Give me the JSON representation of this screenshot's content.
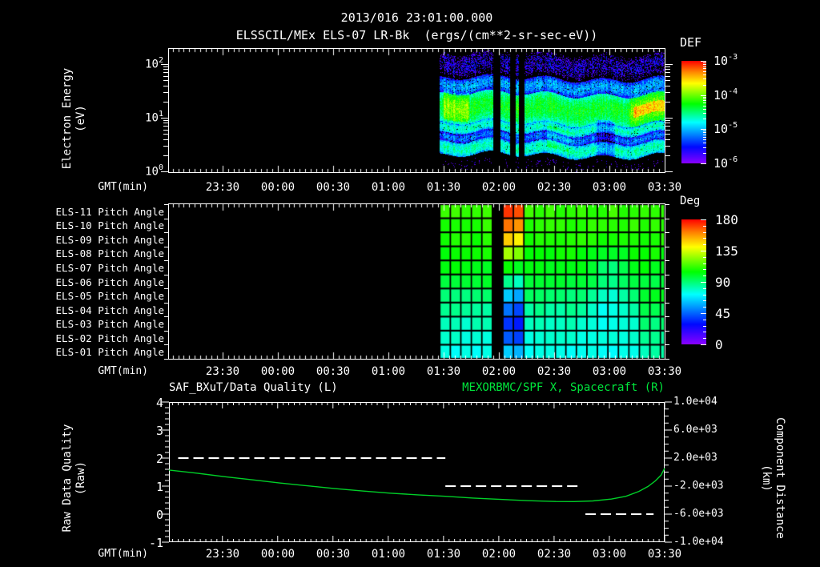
{
  "header": {
    "title": "2013/016 23:01:00.000",
    "subtitle": "ELSSCIL/MEx ELS-07 LR-Bk  (ergs/(cm**2-sr-sec-eV))"
  },
  "time_axis": {
    "label": "GMT(min)",
    "ticks": [
      "23:30",
      "00:00",
      "00:30",
      "01:00",
      "01:30",
      "02:00",
      "02:30",
      "03:00",
      "03:30"
    ]
  },
  "panel1": {
    "ylabel_line1": "Electron Energy",
    "ylabel_line2": "(eV)",
    "ytick_exponents": [
      "2",
      "1",
      "0"
    ],
    "colorbar": {
      "title": "DEF",
      "tick_exponents": [
        "-3",
        "-4",
        "-5",
        "-6"
      ]
    }
  },
  "panel2": {
    "row_labels": [
      "ELS-11 Pitch Angle",
      "ELS-10 Pitch Angle",
      "ELS-09 Pitch Angle",
      "ELS-08 Pitch Angle",
      "ELS-07 Pitch Angle",
      "ELS-06 Pitch Angle",
      "ELS-05 Pitch Angle",
      "ELS-04 Pitch Angle",
      "ELS-03 Pitch Angle",
      "ELS-02 Pitch Angle",
      "ELS-01 Pitch Angle"
    ],
    "colorbar": {
      "title": "Deg",
      "ticks": [
        "180",
        "135",
        "90",
        "45",
        "0"
      ]
    }
  },
  "panel3": {
    "title_left": "SAF_BXuT/Data Quality (L)",
    "title_right": "MEXORBMC/SPF X, Spacecraft (R)",
    "ylabel_left_line1": "Raw Data Quality",
    "ylabel_left_line2": "(Raw)",
    "ylabel_right_line1": "Component Distance",
    "ylabel_right_line2": "(km)",
    "yticks_left": [
      "4",
      "3",
      "2",
      "1",
      "0",
      "-1"
    ],
    "yticks_right": [
      "1.0e+04",
      "6.0e+03",
      "2.0e+03",
      "-2.0e+03",
      "-6.0e+03",
      "-1.0e+04"
    ]
  },
  "colors": {
    "background": "#000000",
    "text": "#ffffff",
    "green_title": "#00e63c",
    "curve_green": "#00cf28",
    "quality_white": "#ffffff"
  },
  "chart_data": [
    {
      "type": "heatmap",
      "name": "electron-energy-spectrogram",
      "title": "ELSSCIL/MEx ELS-07 LR-Bk",
      "units": "ergs/(cm**2-sr-sec-eV)",
      "xlabel": "GMT(min)",
      "ylabel": "Electron Energy (eV)",
      "x_start": "23:01",
      "x_end": "03:30",
      "total_min": 269,
      "x_tick_labels": [
        "23:30",
        "00:00",
        "00:30",
        "01:00",
        "01:30",
        "02:00",
        "02:30",
        "03:00",
        "03:30"
      ],
      "y_scale": "log",
      "y_range_ev": [
        1,
        170
      ],
      "colorbar": {
        "label": "DEF",
        "scale": "log",
        "min": 1e-06,
        "max": 0.001
      },
      "data_start_min": 147,
      "data_gaps_min": [
        [
          176,
          180
        ],
        [
          185,
          188
        ],
        [
          190,
          193
        ]
      ],
      "energy_bands": [
        {
          "e": [
            1.0,
            2.0
          ],
          "flux": 8e-07,
          "dropout": 0.62
        },
        {
          "e": [
            2.0,
            3.6
          ],
          "flux": 1.6e-05,
          "dropout": 0.02
        },
        {
          "e": [
            3.6,
            5.2
          ],
          "flux": 4.5e-06,
          "dropout": 0.05
        },
        {
          "e": [
            5.2,
            8.0
          ],
          "flux": 1.5e-05,
          "dropout": 0.02
        },
        {
          "e": [
            8.0,
            28.0
          ],
          "flux": 4e-05,
          "dropout": 0.0
        },
        {
          "e": [
            28.0,
            55.0
          ],
          "flux": 6e-06,
          "dropout": 0.05
        },
        {
          "e": [
            55.0,
            170.0
          ],
          "flux": 1.6e-06,
          "dropout": 0.3
        }
      ],
      "bright_patches": [
        {
          "t": [
            149,
            163
          ],
          "e": [
            9,
            30
          ],
          "factor": 2.6
        },
        {
          "t": [
            250,
            269
          ],
          "e": [
            8,
            30
          ],
          "factor": 2.2
        },
        {
          "t": [
            252,
            269
          ],
          "e": [
            12,
            19
          ],
          "factor": 3.2
        },
        {
          "t": [
            232,
            242
          ],
          "e": [
            2,
            9
          ],
          "factor": 0.45
        },
        {
          "t": [
            205,
            220
          ],
          "e": [
            2.6,
            6.5
          ],
          "factor": 1.6
        }
      ]
    },
    {
      "type": "heatmap",
      "name": "pitch-angle-panel",
      "rows": [
        "ELS-11",
        "ELS-10",
        "ELS-09",
        "ELS-08",
        "ELS-07",
        "ELS-06",
        "ELS-05",
        "ELS-04",
        "ELS-03",
        "ELS-02",
        "ELS-01"
      ],
      "colorbar": {
        "label": "Deg",
        "min": 0,
        "max": 180,
        "tick_labels": [
          "180",
          "135",
          "90",
          "45",
          "0"
        ]
      },
      "data_start_min": 147,
      "data_gaps_min": [
        [
          176,
          180
        ],
        [
          185,
          188
        ],
        [
          190,
          193
        ],
        [
          264.5,
          267
        ]
      ],
      "column_width_min": 5.7,
      "baseline_deg": [
        108,
        106,
        104,
        101,
        97,
        91,
        83,
        76,
        70,
        66,
        63
      ],
      "stripes": [
        {
          "t": [
            180,
            185
          ],
          "values_deg": [
            172,
            162,
            148,
            126,
            101,
            78,
            52,
            38,
            28,
            34,
            52
          ]
        },
        {
          "t": [
            188,
            190
          ],
          "values_deg": [
            168,
            157,
            142,
            120,
            95,
            70,
            46,
            31,
            24,
            30,
            48
          ]
        }
      ],
      "cyan_blob": {
        "t": [
          226,
          252
        ],
        "rows": [
          3,
          8
        ],
        "delta_deg": -17,
        "center_min": 239,
        "half_width_min": 13
      },
      "right_green": {
        "t": [
          255,
          269
        ],
        "rows": [
          6,
          10
        ],
        "delta_deg": 10
      }
    },
    {
      "type": "line",
      "name": "quality-and-distance",
      "xlabel": "GMT(min)",
      "x_tick_labels": [
        "23:30",
        "00:00",
        "00:30",
        "01:00",
        "01:30",
        "02:00",
        "02:30",
        "03:00",
        "03:30"
      ],
      "total_min": 269,
      "ylim_left": [
        -1,
        4
      ],
      "ylim_right": [
        -10000,
        10000
      ],
      "series": [
        {
          "name": "SAF_BXuT/Data Quality (L)",
          "axis": "left",
          "color": "#ffffff",
          "style": "dashed",
          "segments": [
            {
              "t": [
                5,
                150
              ],
              "value": 2
            },
            {
              "t": [
                150,
                224
              ],
              "value": 1
            },
            {
              "t": [
                226,
                263
              ],
              "value": 0
            }
          ]
        },
        {
          "name": "MEXORBMC/SPF X, Spacecraft (R)",
          "axis": "right",
          "color": "#00cf28",
          "style": "solid",
          "points_min_km": [
            [
              0,
              300
            ],
            [
              15,
              -150
            ],
            [
              30,
              -650
            ],
            [
              45,
              -1100
            ],
            [
              60,
              -1550
            ],
            [
              75,
              -1950
            ],
            [
              90,
              -2350
            ],
            [
              105,
              -2700
            ],
            [
              120,
              -3000
            ],
            [
              135,
              -3250
            ],
            [
              150,
              -3450
            ],
            [
              165,
              -3700
            ],
            [
              180,
              -3900
            ],
            [
              195,
              -4080
            ],
            [
              210,
              -4190
            ],
            [
              220,
              -4210
            ],
            [
              230,
              -4120
            ],
            [
              240,
              -3850
            ],
            [
              248,
              -3450
            ],
            [
              255,
              -2750
            ],
            [
              260,
              -2050
            ],
            [
              264,
              -1250
            ],
            [
              267,
              -450
            ],
            [
              269,
              550
            ]
          ]
        }
      ]
    }
  ]
}
